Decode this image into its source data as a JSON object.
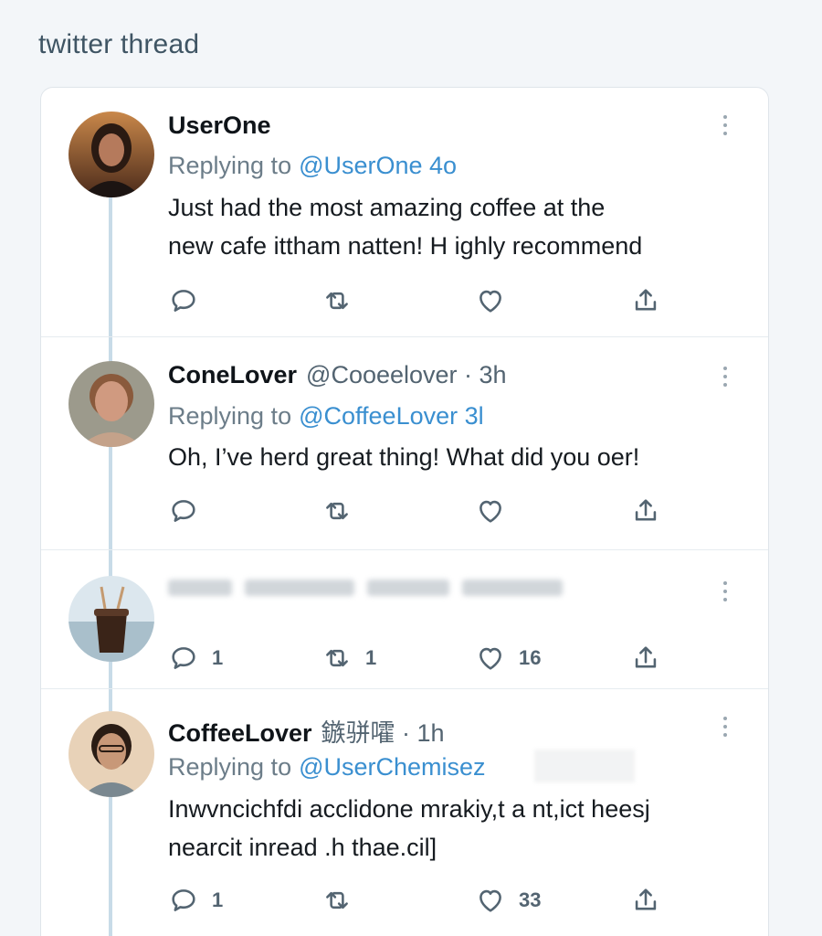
{
  "page": {
    "heading": "twitter thread"
  },
  "tweets": [
    {
      "display_name": "UserOne",
      "handle_meta": "",
      "reply_prefix": "Replying to",
      "reply_handle": "@UserOne 4o",
      "text_lines": [
        "Just had the most amazing coffee at the",
        "new cafe ittham natten! H ighly recommend"
      ],
      "counts": {
        "reply": "",
        "retweet": "",
        "like": ""
      }
    },
    {
      "display_name": "ConeLover",
      "handle_meta": "@Cooeelover · 3h",
      "reply_prefix": "Replying to",
      "reply_handle": "@CoffeeLover 3l",
      "text_lines": [
        "Oh, I’ve herd great thing! What did you oer!"
      ],
      "counts": {
        "reply": "",
        "retweet": "",
        "like": ""
      }
    },
    {
      "display_name": "",
      "handle_meta": "",
      "reply_prefix": "",
      "reply_handle": "",
      "text_lines": [],
      "counts": {
        "reply": "1",
        "retweet": "1",
        "like": "16"
      }
    },
    {
      "display_name": "CoffeeLover",
      "handle_meta": "鏃骈嚯 · 1h",
      "reply_prefix": "Replying to",
      "reply_handle": "@UserChemisez",
      "text_lines": [
        "Inwvncichfdi acclidone mrakiy,t a nt,ict heesj",
        "nearcit inread .h thae.cil]"
      ],
      "counts": {
        "reply": "1",
        "retweet": "",
        "like": "33"
      }
    }
  ],
  "icons": {
    "reply": "reply-icon",
    "retweet": "retweet-icon",
    "like": "heart-icon",
    "share": "share-icon",
    "more": "more-options-icon"
  },
  "colors": {
    "accent": "#3a8fd0",
    "icon": "#536471",
    "thread_line": "#c8dbe8"
  }
}
